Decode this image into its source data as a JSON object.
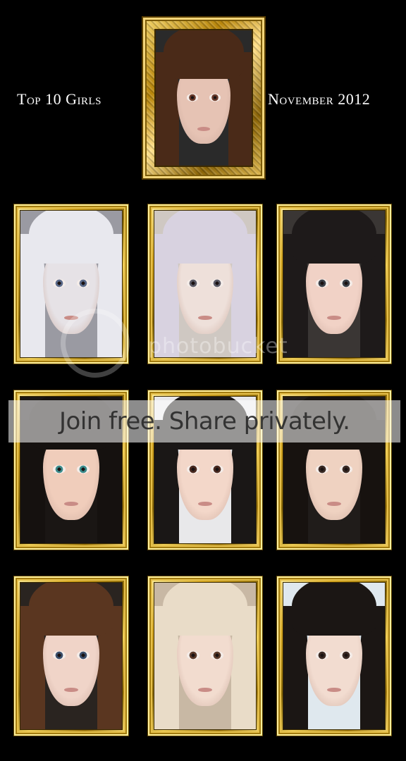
{
  "header": {
    "title_left": "Top 10 Girls",
    "title_right": "November 2012"
  },
  "watermark": {
    "logo_text": "photobucket",
    "banner_text": "Join free. Share privately."
  },
  "portraits": [
    {
      "hair": "#4a2a18",
      "skin": "#e6c3b4",
      "bg": "#2a2a2a",
      "eye": "#6a3a2a"
    },
    {
      "hair": "#e8e8ee",
      "skin": "#e6e2e6",
      "bg": "#9a9aa2",
      "eye": "#5a6a8a"
    },
    {
      "hair": "#d8d2e0",
      "skin": "#eee0da",
      "bg": "#cfc8c2",
      "eye": "#5a5a66"
    },
    {
      "hair": "#1e1a1a",
      "skin": "#f1d2c6",
      "bg": "#3a3634",
      "eye": "#3a4048"
    },
    {
      "hair": "#15110f",
      "skin": "#f0cdbb",
      "bg": "#1a1614",
      "eye": "#3a8a8a"
    },
    {
      "hair": "#1a1716",
      "skin": "#f3d7c9",
      "bg": "#e8e8ea",
      "eye": "#4a2a20"
    },
    {
      "hair": "#17120f",
      "skin": "#efd2c1",
      "bg": "#201c1a",
      "eye": "#3a2a24"
    },
    {
      "hair": "#5a3620",
      "skin": "#f0d4c8",
      "bg": "#2a2420",
      "eye": "#3a4e6a"
    },
    {
      "hair": "#e9dcc8",
      "skin": "#f2dccf",
      "bg": "#c8b8a4",
      "eye": "#5a3a2a"
    },
    {
      "hair": "#1b1614",
      "skin": "#f2dcd0",
      "bg": "#dfe8ee",
      "eye": "#3a2a24"
    }
  ]
}
